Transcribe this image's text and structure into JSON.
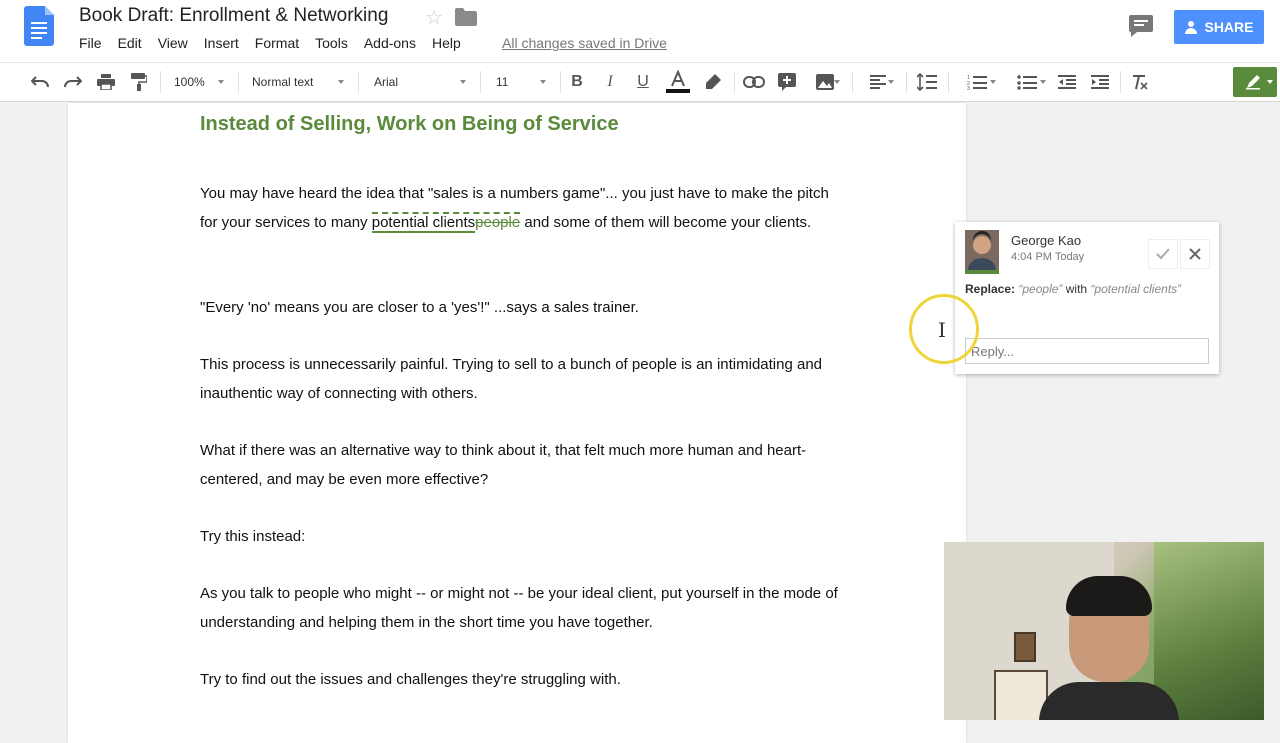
{
  "header": {
    "title": "Book Draft: Enrollment & Networking",
    "menu": [
      "File",
      "Edit",
      "View",
      "Insert",
      "Format",
      "Tools",
      "Add-ons",
      "Help"
    ],
    "saved_status": "All changes saved in Drive",
    "share_label": "SHARE"
  },
  "toolbar": {
    "zoom": "100%",
    "style": "Normal text",
    "font": "Arial",
    "font_size": "11"
  },
  "document": {
    "heading": "Instead of Selling, Work on Being of Service",
    "p1_before": "You may have heard the idea that \"sales is a numbers game\"... you just have to make the pitch for your services to many ",
    "p1_insert": "potential clients",
    "p1_delete": "people",
    "p1_after": " and some of them will become your clients.",
    "p2": "\"Every 'no' means you are closer to a 'yes'!\" ...says a sales trainer.",
    "p3": "This process is unnecessarily painful. Trying to sell to a bunch of people is an intimidating and inauthentic way of connecting with others.",
    "p4": "What if there was an alternative way to think about it, that felt much more human and heart-centered, and may be even more effective?",
    "p5": "Try this instead:",
    "p6": "As you talk to people who might -- or might not -- be your ideal client, put yourself in the mode of understanding and helping them in the short time you have together.",
    "p7": "Try to find out the issues and challenges they're struggling with."
  },
  "comment": {
    "author": "George Kao",
    "time": "4:04 PM Today",
    "action_label": "Replace:",
    "old_text": "“people”",
    "with_word": "with",
    "new_text": "“potential clients”",
    "reply_placeholder": "Reply..."
  },
  "colors": {
    "accent_green": "#5a8a3b",
    "share_blue": "#4d90fe",
    "doc_blue": "#4285f4"
  }
}
